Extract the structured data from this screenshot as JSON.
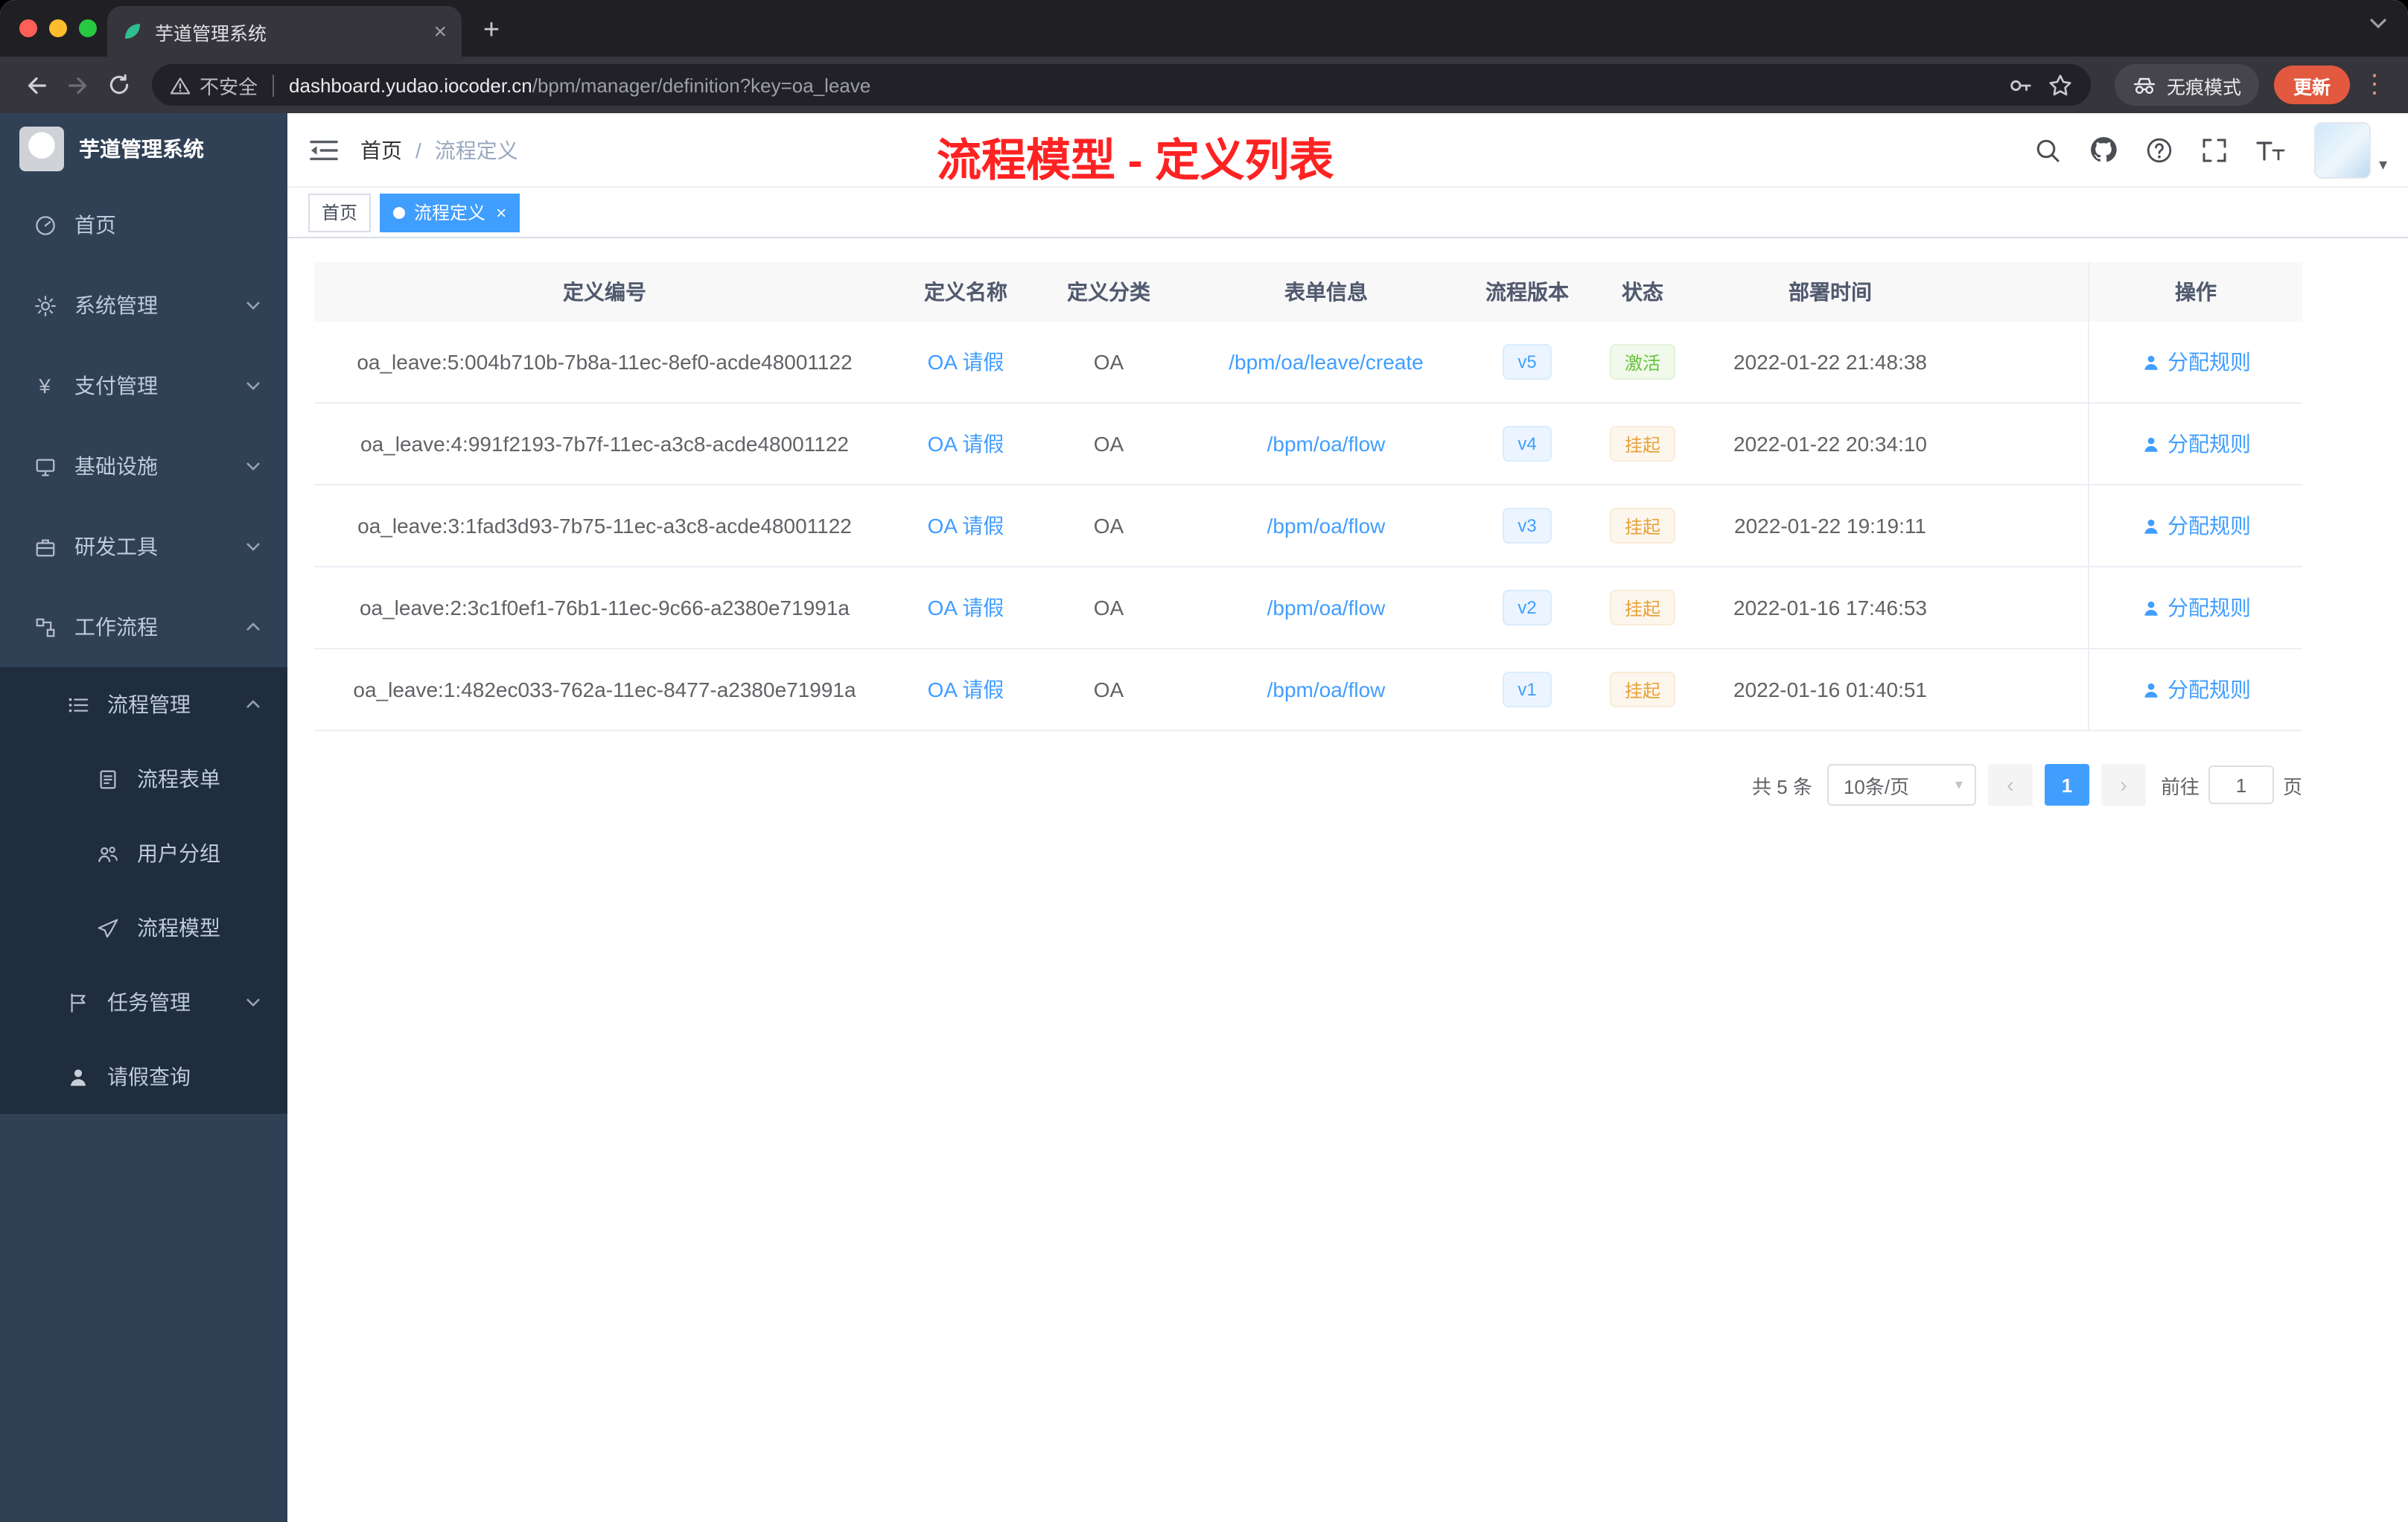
{
  "colors": {
    "accent": "#409eff",
    "success": "#67c23a",
    "warning": "#e6a23c",
    "annotation": "#ff2222",
    "update_chip": "#e2593f",
    "sidebar_bg": "#304156"
  },
  "icons": {
    "close": "×",
    "plus": "+",
    "kebab": "⋮",
    "caret_down": "▾",
    "prev": "‹",
    "next": "›",
    "yen": "¥"
  },
  "browser": {
    "tab_title": "芋道管理系统",
    "security_label": "不安全",
    "url_domain": "dashboard.yudao.iocoder.cn",
    "url_path": "/bpm/manager/definition?key=oa_leave",
    "incognito_label": "无痕模式",
    "update_label": "更新"
  },
  "sidebar": {
    "logo_title": "芋道管理系统",
    "items": [
      {
        "label": "首页"
      },
      {
        "label": "系统管理"
      },
      {
        "label": "支付管理"
      },
      {
        "label": "基础设施"
      },
      {
        "label": "研发工具"
      },
      {
        "label": "工作流程"
      },
      {
        "label": "流程管理"
      },
      {
        "label": "流程表单"
      },
      {
        "label": "用户分组"
      },
      {
        "label": "流程模型"
      },
      {
        "label": "任务管理"
      },
      {
        "label": "请假查询"
      }
    ]
  },
  "header": {
    "breadcrumb_home": "首页",
    "breadcrumb_sep": "/",
    "breadcrumb_current": "流程定义",
    "annotation": "流程模型 - 定义列表"
  },
  "tags": {
    "home": "首页",
    "current": "流程定义"
  },
  "table": {
    "columns": {
      "id": "定义编号",
      "name": "定义名称",
      "category": "定义分类",
      "form": "表单信息",
      "version": "流程版本",
      "status": "状态",
      "deploy_time": "部署时间",
      "actions": "操作"
    },
    "rows": [
      {
        "id": "oa_leave:5:004b710b-7b8a-11ec-8ef0-acde48001122",
        "name": "OA 请假",
        "category": "OA",
        "form": "/bpm/oa/leave/create",
        "version": "v5",
        "status": "激活",
        "deploy_time": "2022-01-22 21:48:38",
        "action": "分配规则"
      },
      {
        "id": "oa_leave:4:991f2193-7b7f-11ec-a3c8-acde48001122",
        "name": "OA 请假",
        "category": "OA",
        "form": "/bpm/oa/flow",
        "version": "v4",
        "status": "挂起",
        "deploy_time": "2022-01-22 20:34:10",
        "action": "分配规则"
      },
      {
        "id": "oa_leave:3:1fad3d93-7b75-11ec-a3c8-acde48001122",
        "name": "OA 请假",
        "category": "OA",
        "form": "/bpm/oa/flow",
        "version": "v3",
        "status": "挂起",
        "deploy_time": "2022-01-22 19:19:11",
        "action": "分配规则"
      },
      {
        "id": "oa_leave:2:3c1f0ef1-76b1-11ec-9c66-a2380e71991a",
        "name": "OA 请假",
        "category": "OA",
        "form": "/bpm/oa/flow",
        "version": "v2",
        "status": "挂起",
        "deploy_time": "2022-01-16 17:46:53",
        "action": "分配规则"
      },
      {
        "id": "oa_leave:1:482ec033-762a-11ec-8477-a2380e71991a",
        "name": "OA 请假",
        "category": "OA",
        "form": "/bpm/oa/flow",
        "version": "v1",
        "status": "挂起",
        "deploy_time": "2022-01-16 01:40:51",
        "action": "分配规则"
      }
    ]
  },
  "pagination": {
    "total": "共 5 条",
    "page_size": "10条/页",
    "page": "1",
    "goto_prefix": "前往",
    "goto_value": "1",
    "goto_suffix": "页"
  }
}
